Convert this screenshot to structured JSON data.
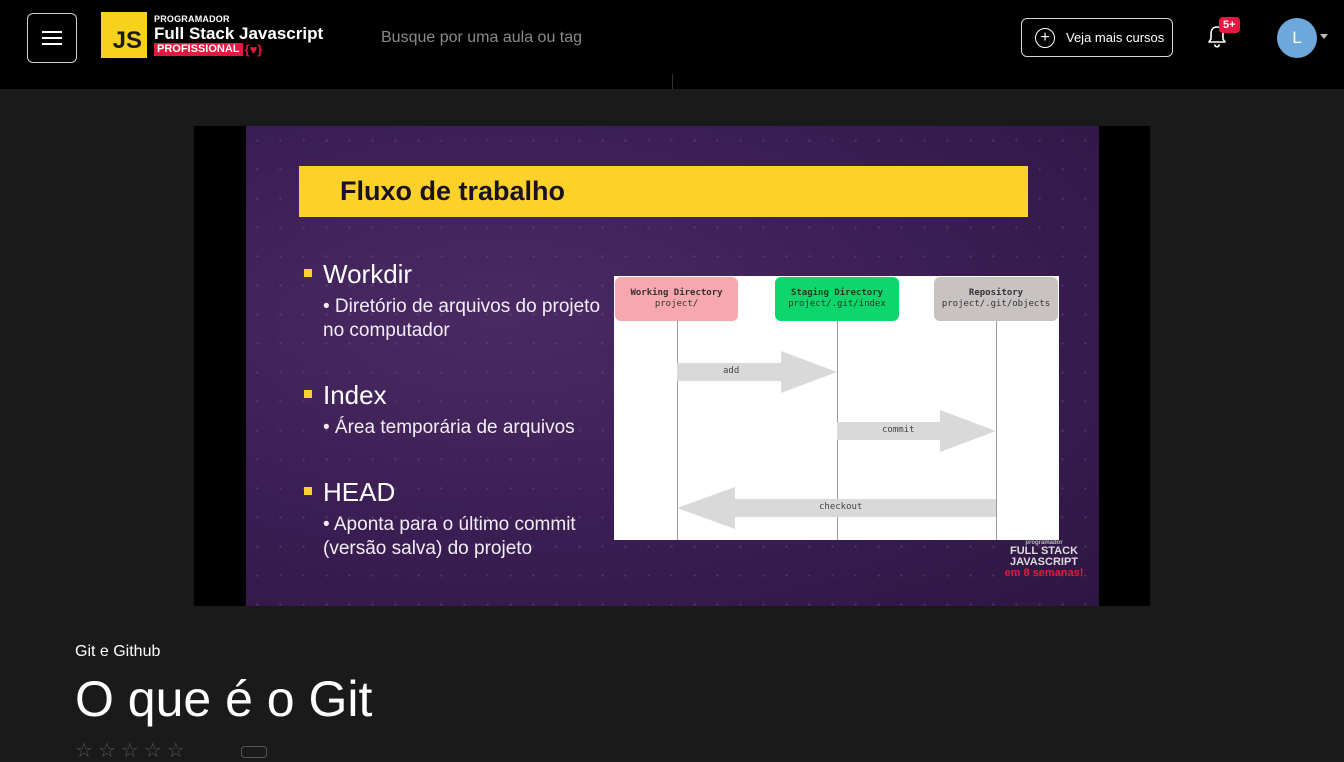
{
  "header": {
    "menu_icon": "hamburger-menu-icon",
    "logo": {
      "mark": "JS",
      "top": "PROGRAMADOR",
      "middle": "Full Stack Javascript",
      "bottom": "PROFISSIONAL",
      "brace": "{♥}"
    },
    "search_placeholder": "Busque por uma aula ou tag",
    "more_courses_label": "Veja mais cursos",
    "notifications_badge": "5+",
    "avatar_initial": "L",
    "colors": {
      "accent_red": "#e5193f",
      "logo_yellow": "#f7d21c",
      "avatar_blue": "#6ea7dc"
    }
  },
  "video": {
    "slide_title": "Fluxo de trabalho",
    "bullets": [
      {
        "head": "Workdir",
        "sub": "• Diretório de arquivos do projeto no computador"
      },
      {
        "head": "Index",
        "sub": "• Área temporária de arquivos"
      },
      {
        "head": "HEAD",
        "sub": "• Aponta para o último commit (versão salva) do projeto"
      }
    ],
    "diagram": {
      "nodes": [
        {
          "title": "Working Directory",
          "path": "project/"
        },
        {
          "title": "Staging Directory",
          "path": "project/.git/index"
        },
        {
          "title": "Repository",
          "path": "project/.git/objects"
        }
      ],
      "arrows": [
        "add",
        "commit",
        "checkout"
      ]
    },
    "watermark": {
      "line1": "programador",
      "line2": "FULL STACK",
      "line3": "JAVASCRIPT",
      "line4": "em 8 semanas!"
    },
    "colors": {
      "title_bar": "#fcd12a",
      "node_working": "#f7a8ae",
      "node_staging": "#0fd66c",
      "node_repo": "#c9c2c2"
    }
  },
  "lesson": {
    "course": "Git e Github",
    "title": "O que é o Git",
    "rating_stars": 5
  }
}
